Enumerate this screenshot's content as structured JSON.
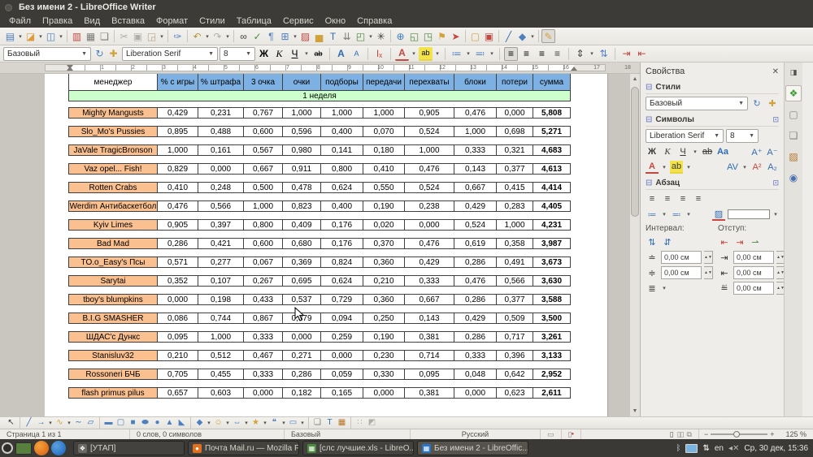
{
  "window": {
    "title": "Без имени 2 - LibreOffice Writer"
  },
  "menu": {
    "items": [
      "Файл",
      "Правка",
      "Вид",
      "Вставка",
      "Формат",
      "Стили",
      "Таблица",
      "Сервис",
      "Окно",
      "Справка"
    ]
  },
  "toolbar_std": {
    "items": [
      {
        "n": "new-document-icon",
        "g": "▤",
        "c": "#4E7FC1",
        "dd": 1
      },
      {
        "n": "open-icon",
        "g": "◪",
        "c": "#E09A3C",
        "dd": 1
      },
      {
        "n": "save-icon",
        "g": "◫",
        "c": "#4E7FC1",
        "dd": 1
      },
      {
        "sep": 1
      },
      {
        "n": "export-pdf-icon",
        "g": "▥",
        "c": "#C5473F"
      },
      {
        "n": "print-icon",
        "g": "▦",
        "c": "#7C7C7A"
      },
      {
        "n": "print-preview-icon",
        "g": "❏",
        "c": "#7C7C7A"
      },
      {
        "sep": 1
      },
      {
        "n": "cut-icon",
        "g": "✂",
        "c": "#B0AEAB"
      },
      {
        "n": "copy-icon",
        "g": "▣",
        "c": "#B0AEAB"
      },
      {
        "n": "paste-icon",
        "g": "◲",
        "c": "#B8A489",
        "dd": 1
      },
      {
        "sep": 1
      },
      {
        "n": "clone-formatting-icon",
        "g": "✑",
        "c": "#4E7FC1"
      },
      {
        "sep": 1
      },
      {
        "n": "undo-icon",
        "g": "↶",
        "c": "#B8973A",
        "dd": 1
      },
      {
        "n": "redo-icon",
        "g": "↷",
        "c": "#B0AEAB",
        "dd": 1
      },
      {
        "sep": 1
      },
      {
        "n": "find-replace-icon",
        "g": "∞",
        "c": "#3D3D3B"
      },
      {
        "n": "spelling-icon",
        "g": "✓",
        "c": "#4A8A3C"
      },
      {
        "n": "formatting-marks-icon",
        "g": "¶",
        "c": "#4E7FC1"
      },
      {
        "n": "insert-table-icon",
        "g": "⊞",
        "c": "#4E7FC1",
        "dd": 1
      },
      {
        "n": "insert-image-icon",
        "g": "▨",
        "c": "#C5473F"
      },
      {
        "n": "insert-chart-icon",
        "g": "▅",
        "c": "#D1A23B"
      },
      {
        "n": "insert-textbox-icon",
        "g": "T",
        "c": "#2F6CB3"
      },
      {
        "n": "page-break-icon",
        "g": "⇊",
        "c": "#7C7C7A"
      },
      {
        "n": "insert-field-icon",
        "g": "◰",
        "c": "#4A8A3C",
        "dd": 1
      },
      {
        "n": "insert-special-char-icon",
        "g": "✳",
        "c": "#3D3D3B"
      },
      {
        "sep": 1
      },
      {
        "n": "hyperlink-icon",
        "g": "⊕",
        "c": "#3A7EC0"
      },
      {
        "n": "footnote-icon",
        "g": "◱",
        "c": "#4A8A3C"
      },
      {
        "n": "endnote-icon",
        "g": "◳",
        "c": "#4A8A3C"
      },
      {
        "n": "bookmark-icon",
        "g": "⚑",
        "c": "#D1A23B"
      },
      {
        "n": "cross-reference-icon",
        "g": "➤",
        "c": "#C5473F"
      },
      {
        "sep": 1
      },
      {
        "n": "insert-comment-icon",
        "g": "▢",
        "c": "#D1A23B"
      },
      {
        "n": "track-changes-icon",
        "g": "▣",
        "c": "#C5473F"
      },
      {
        "sep": 1
      },
      {
        "n": "insert-line-icon",
        "g": "╱",
        "c": "#2F6CB3"
      },
      {
        "n": "basic-shapes-icon",
        "g": "◆",
        "c": "#4E7FC1",
        "dd": 1
      },
      {
        "sep": 1
      },
      {
        "n": "show-draw-functions-icon",
        "g": "✎",
        "c": "#D1A23B",
        "boxed": 1
      }
    ]
  },
  "fmt": {
    "style_value": "Базовый",
    "font_value": "Liberation Serif",
    "size_value": "8",
    "items": [
      {
        "n": "update-style-icon",
        "g": "↻",
        "c": "#4E7FC1"
      },
      {
        "n": "new-style-icon",
        "g": "✚",
        "c": "#D1A23B"
      },
      {
        "gap": 1
      },
      {
        "n": "bold-icon",
        "g": "Ж",
        "cls": "b"
      },
      {
        "n": "italic-icon",
        "g": "K",
        "cls": "i"
      },
      {
        "n": "underline-icon",
        "g": "Ч",
        "cls": "u",
        "dd": 1
      },
      {
        "n": "strikethrough-icon",
        "g": "ab",
        "cls": "s"
      },
      {
        "sep": 1
      },
      {
        "n": "grow-font-icon",
        "g": "A",
        "cls": "b",
        "c": "#2F6CB3"
      },
      {
        "n": "shrink-font-icon",
        "g": "A",
        "cls": "sm",
        "c": "#2F6CB3"
      },
      {
        "sep": 1
      },
      {
        "n": "clear-formatting-icon",
        "g": "Iₓ",
        "c": "#C5473F"
      },
      {
        "sep": 1
      },
      {
        "n": "font-color-icon",
        "g": "A",
        "cls": "fc",
        "dd": 1
      },
      {
        "n": "highlight-icon",
        "g": "ab",
        "cls": "hl",
        "dd": 1
      },
      {
        "sep": 1
      },
      {
        "n": "bullets-icon",
        "g": "≔",
        "c": "#4E7FC1",
        "dd": 1
      },
      {
        "n": "numbering-icon",
        "g": "≕",
        "c": "#4E7FC1",
        "dd": 1
      },
      {
        "sep": 1
      },
      {
        "n": "align-left-icon",
        "g": "≡",
        "boxed": 1
      },
      {
        "n": "align-center-icon",
        "g": "≡"
      },
      {
        "n": "align-right-icon",
        "g": "≡"
      },
      {
        "n": "align-justify-icon",
        "g": "≡",
        "c": "#3D3D3B"
      },
      {
        "sep": 1
      },
      {
        "n": "line-spacing-icon",
        "g": "⇕",
        "c": "#3D3D3B",
        "dd": 1
      },
      {
        "n": "paragraph-spacing-icon",
        "g": "⇅",
        "c": "#4E7FC1"
      },
      {
        "sep": 1
      },
      {
        "n": "indent-increase-icon",
        "g": "⇥",
        "c": "#C5473F"
      },
      {
        "n": "indent-decrease-icon",
        "g": "⇤",
        "c": "#C5473F"
      }
    ]
  },
  "ruler": {
    "numbers": [
      "1",
      "2",
      "3",
      "4",
      "5",
      "6",
      "7",
      "8",
      "9",
      "10",
      "11",
      "12",
      "13",
      "14",
      "15",
      "16",
      "17",
      "18"
    ]
  },
  "table": {
    "headers": [
      "менеджер",
      "% с игры",
      "% штрафа",
      "3 очка",
      "очки",
      "подборы",
      "передачи",
      "перехваты",
      "блоки",
      "потери",
      "сумма"
    ],
    "week": "1 неделя",
    "rows": [
      {
        "name": "Mighty Mangusts",
        "values": [
          "0,429",
          "0,231",
          "0,767",
          "1,000",
          "1,000",
          "1,000",
          "0,905",
          "0,476",
          "0,000"
        ],
        "sum": "5,808"
      },
      {
        "name": "Slo_Mo's Pussies",
        "values": [
          "0,895",
          "0,488",
          "0,600",
          "0,596",
          "0,400",
          "0,070",
          "0,524",
          "1,000",
          "0,698"
        ],
        "sum": "5,271"
      },
      {
        "name": "JaVale TragicBronson",
        "values": [
          "1,000",
          "0,161",
          "0,567",
          "0,980",
          "0,141",
          "0,180",
          "1,000",
          "0,333",
          "0,321"
        ],
        "sum": "4,683"
      },
      {
        "name": "Vaz opel... Fish!",
        "values": [
          "0,829",
          "0,000",
          "0,667",
          "0,911",
          "0,800",
          "0,410",
          "0,476",
          "0,143",
          "0,377"
        ],
        "sum": "4,613"
      },
      {
        "name": "Rotten Crabs",
        "values": [
          "0,410",
          "0,248",
          "0,500",
          "0,478",
          "0,624",
          "0,550",
          "0,524",
          "0,667",
          "0,415"
        ],
        "sum": "4,414"
      },
      {
        "name": "Werdim Антибаскетбол",
        "values": [
          "0,476",
          "0,566",
          "1,000",
          "0,823",
          "0,400",
          "0,190",
          "0,238",
          "0,429",
          "0,283"
        ],
        "sum": "4,405"
      },
      {
        "name": "Kyiv Limes",
        "values": [
          "0,905",
          "0,397",
          "0,800",
          "0,409",
          "0,176",
          "0,020",
          "0,000",
          "0,524",
          "1,000"
        ],
        "sum": "4,231"
      },
      {
        "name": "Bad Mad",
        "values": [
          "0,286",
          "0,421",
          "0,600",
          "0,680",
          "0,176",
          "0,370",
          "0,476",
          "0,619",
          "0,358"
        ],
        "sum": "3,987"
      },
      {
        "name": "TO.o_Easy's Псы",
        "values": [
          "0,571",
          "0,277",
          "0,067",
          "0,369",
          "0,824",
          "0,360",
          "0,429",
          "0,286",
          "0,491"
        ],
        "sum": "3,673"
      },
      {
        "name": "Sarytai",
        "values": [
          "0,352",
          "0,107",
          "0,267",
          "0,695",
          "0,624",
          "0,210",
          "0,333",
          "0,476",
          "0,566"
        ],
        "sum": "3,630"
      },
      {
        "name": "tboy's blumpkins",
        "values": [
          "0,000",
          "0,198",
          "0,433",
          "0,537",
          "0,729",
          "0,360",
          "0,667",
          "0,286",
          "0,377"
        ],
        "sum": "3,588"
      },
      {
        "name": "B.I.G SMASHER",
        "values": [
          "0,086",
          "0,744",
          "0,867",
          "0,379",
          "0,094",
          "0,250",
          "0,143",
          "0,429",
          "0,509"
        ],
        "sum": "3,500"
      },
      {
        "name": "ШДАС'с Дункс",
        "values": [
          "0,095",
          "1,000",
          "0,333",
          "0,000",
          "0,259",
          "0,190",
          "0,381",
          "0,286",
          "0,717"
        ],
        "sum": "3,261"
      },
      {
        "name": "Stanisluv32",
        "values": [
          "0,210",
          "0,512",
          "0,467",
          "0,271",
          "0,000",
          "0,230",
          "0,714",
          "0,333",
          "0,396"
        ],
        "sum": "3,133"
      },
      {
        "name": "Rossoneri БЧБ",
        "values": [
          "0,705",
          "0,455",
          "0,333",
          "0,286",
          "0,059",
          "0,330",
          "0,095",
          "0,048",
          "0,642"
        ],
        "sum": "2,952"
      },
      {
        "name": "flash primus pilus",
        "values": [
          "0,657",
          "0,603",
          "0,000",
          "0,182",
          "0,165",
          "0,000",
          "0,381",
          "0,000",
          "0,623"
        ],
        "sum": "2,611"
      }
    ]
  },
  "sidebar": {
    "title": "Свойства",
    "styles": {
      "label": "Стили",
      "value": "Базовый"
    },
    "chars": {
      "label": "Символы",
      "font": "Liberation Serif",
      "size": "8"
    },
    "para": {
      "label": "Абзац",
      "spacing_label": "Интервал:",
      "indent_label": "Отступ:",
      "spins": [
        "0,00 см",
        "0,00 см",
        "0,00 см",
        "0,00 см",
        "0,00 см"
      ]
    }
  },
  "drawbar": {
    "items": [
      {
        "n": "select-icon",
        "g": "↖",
        "c": "#3D3D3B"
      },
      {
        "sep": 1
      },
      {
        "n": "line-icon",
        "g": "╱",
        "c": "#2F6CB3"
      },
      {
        "n": "line-arrow-icon",
        "g": "→",
        "c": "#2F6CB3",
        "dd": 1
      },
      {
        "n": "curve-icon",
        "g": "∿",
        "c": "#D1A23B",
        "dd": 1
      },
      {
        "n": "freeform-line-icon",
        "g": "∼",
        "c": "#2F6CB3"
      },
      {
        "n": "polygon-icon",
        "g": "▱",
        "c": "#2F6CB3"
      },
      {
        "sep": 1
      },
      {
        "n": "rectangle-icon",
        "g": "▬",
        "c": "#4E7FC1"
      },
      {
        "n": "rounded-rectangle-icon",
        "g": "▢",
        "c": "#4E7FC1"
      },
      {
        "n": "square-icon",
        "g": "■",
        "c": "#4E7FC1"
      },
      {
        "n": "ellipse-icon",
        "g": "⬬",
        "c": "#4E7FC1"
      },
      {
        "n": "circle-icon",
        "g": "●",
        "c": "#4E7FC1"
      },
      {
        "n": "isosceles-triangle-icon",
        "g": "▲",
        "c": "#4E7FC1"
      },
      {
        "n": "right-triangle-icon",
        "g": "◣",
        "c": "#4E7FC1"
      },
      {
        "sep": 1
      },
      {
        "n": "basic-shapes-icon",
        "g": "◆",
        "c": "#4E7FC1",
        "dd": 1
      },
      {
        "n": "symbol-shapes-icon",
        "g": "☺",
        "c": "#D1A23B",
        "dd": 1
      },
      {
        "n": "block-arrows-icon",
        "g": "⇔",
        "c": "#4E7FC1",
        "dd": 1
      },
      {
        "n": "stars-icon",
        "g": "★",
        "c": "#D1A23B",
        "dd": 1
      },
      {
        "n": "callouts-icon",
        "g": "❝",
        "c": "#4E7FC1",
        "dd": 1
      },
      {
        "n": "flowchart-icon",
        "g": "▭",
        "c": "#4E7FC1",
        "dd": 1
      },
      {
        "sep": 1
      },
      {
        "n": "callout-icon",
        "g": "❏",
        "c": "#7C7C7A"
      },
      {
        "n": "fontwork-icon",
        "g": "T",
        "c": "#2F6CB3"
      },
      {
        "n": "image-frame-icon",
        "g": "▦",
        "c": "#B5762A"
      },
      {
        "sep": 1
      },
      {
        "n": "edit-points-icon",
        "g": "∷",
        "c": "#B0AEAB"
      },
      {
        "n": "toggle-extrusion-icon",
        "g": "◩",
        "c": "#B0AEAB"
      }
    ]
  },
  "statusbar": {
    "page": "Страница 1 из 1",
    "words": "0 слов, 0 символов",
    "style": "Базовый",
    "language": "Русский",
    "zoom": "125 %"
  },
  "taskbar": {
    "windows": [
      {
        "title": "[УТАП]",
        "icon": "generic"
      },
      {
        "title": "Почта Mail.ru — Mozilla Fi...",
        "icon": "firefox"
      },
      {
        "title": "[слс лучшие.xls - LibreO...",
        "icon": "calc"
      },
      {
        "title": "Без имени 2 - LibreOffic...",
        "icon": "writer",
        "active": true
      }
    ],
    "tray": {
      "layout": "en",
      "clock": "Ср, 30 дек, 15:36"
    }
  }
}
